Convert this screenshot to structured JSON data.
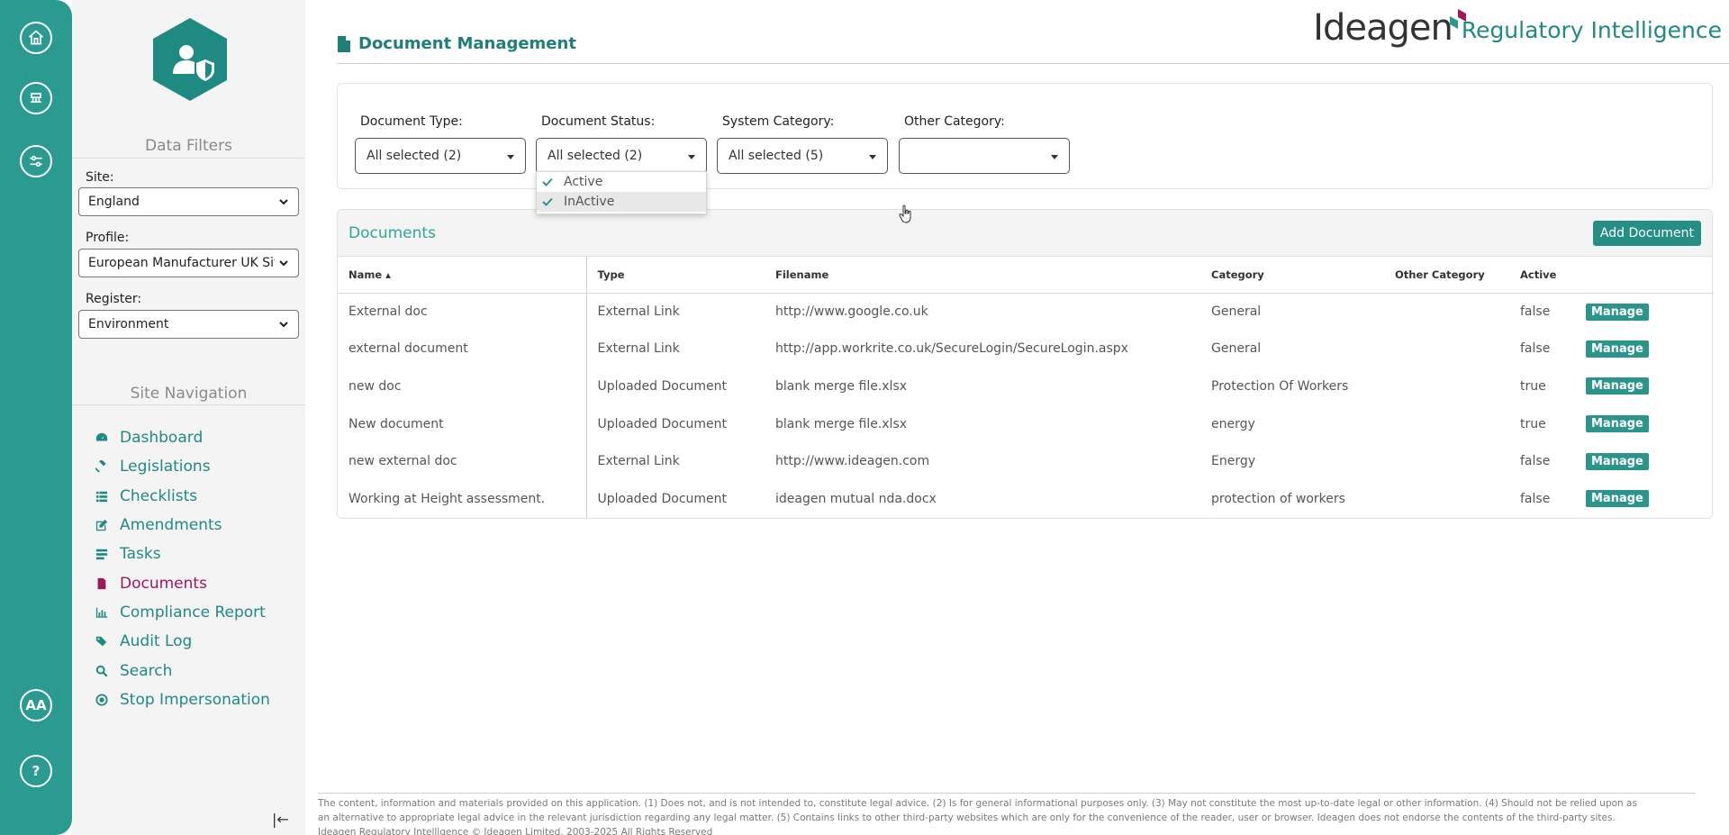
{
  "rail": {
    "avatar_initials": "AA",
    "help_label": "?"
  },
  "sidebar": {
    "data_filters_title": "Data Filters",
    "site_label": "Site:",
    "site_value": "England",
    "profile_label": "Profile:",
    "profile_value": "European Manufacturer UK Site",
    "register_label": "Register:",
    "register_value": "Environment",
    "site_navigation_title": "Site Navigation",
    "nav": [
      {
        "label": "Dashboard",
        "icon": "dashboard-icon"
      },
      {
        "label": "Legislations",
        "icon": "gavel-icon"
      },
      {
        "label": "Checklists",
        "icon": "list-icon"
      },
      {
        "label": "Amendments",
        "icon": "edit-icon"
      },
      {
        "label": "Tasks",
        "icon": "tasks-icon"
      },
      {
        "label": "Documents",
        "icon": "document-icon"
      },
      {
        "label": "Compliance Report",
        "icon": "bar-chart-icon"
      },
      {
        "label": "Audit Log",
        "icon": "tags-icon"
      },
      {
        "label": "Search",
        "icon": "search-icon"
      },
      {
        "label": "Stop Impersonation",
        "icon": "stop-circle-icon"
      }
    ],
    "active_nav": "Documents"
  },
  "header": {
    "page_title": "Document Management",
    "brand_name": "Ideagen",
    "brand_product": "Regulatory Intelligence"
  },
  "filters": {
    "document_type_label": "Document Type:",
    "document_type_value": "All selected (2)",
    "document_status_label": "Document Status:",
    "document_status_value": "All selected (2)",
    "system_category_label": "System Category:",
    "system_category_value": "All selected (5)",
    "other_category_label": "Other Category:",
    "other_category_value": "",
    "status_options": [
      "Active",
      "InActive"
    ]
  },
  "documents": {
    "title": "Documents",
    "add_button": "Add Document",
    "columns": [
      "Name ▴",
      "Type",
      "Filename",
      "Category",
      "Other Category",
      "Active",
      ""
    ],
    "manage_label": "Manage",
    "rows": [
      {
        "name": "External doc",
        "type": "External Link",
        "filename": "http://www.google.co.uk",
        "category": "General",
        "other": "",
        "active": "false"
      },
      {
        "name": "external document",
        "type": "External Link",
        "filename": "http://app.workrite.co.uk/SecureLogin/SecureLogin.aspx",
        "category": "General",
        "other": "",
        "active": "false"
      },
      {
        "name": "new doc",
        "type": "Uploaded Document",
        "filename": "blank merge file.xlsx",
        "category": "Protection Of Workers",
        "other": "",
        "active": "true"
      },
      {
        "name": "New document",
        "type": "Uploaded Document",
        "filename": "blank merge file.xlsx",
        "category": "energy",
        "other": "",
        "active": "true"
      },
      {
        "name": "new external doc",
        "type": "External Link",
        "filename": "http://www.ideagen.com",
        "category": "Energy",
        "other": "",
        "active": "false"
      },
      {
        "name": "Working at Height assessment.",
        "type": "Uploaded Document",
        "filename": "ideagen mutual nda.docx",
        "category": "protection of workers",
        "other": "",
        "active": "false"
      }
    ]
  },
  "footer": {
    "line1": "The content, information and materials provided on this application. (1) Does not, and is not intended to, constitute legal advice. (2) Is for general informational purposes only. (3) May not constitute the most up-to-date legal or other information. (4) Should not be relied upon as",
    "line2": "an alternative to appropriate legal advice in the relevant jurisdiction regarding any legal matter. (5) Contains links to other third-party websites which are only for the convenience of the reader, user or browser. Ideagen does not endorse the contents of the third-party sites.",
    "line3": "Ideagen Regulatory Intelligence © Ideagen Limited. 2003-2025 All Rights Reserved"
  },
  "colors": {
    "brand_teal": "#2b9a91",
    "active_nav": "#a0185c",
    "button_teal": "#258f86"
  }
}
